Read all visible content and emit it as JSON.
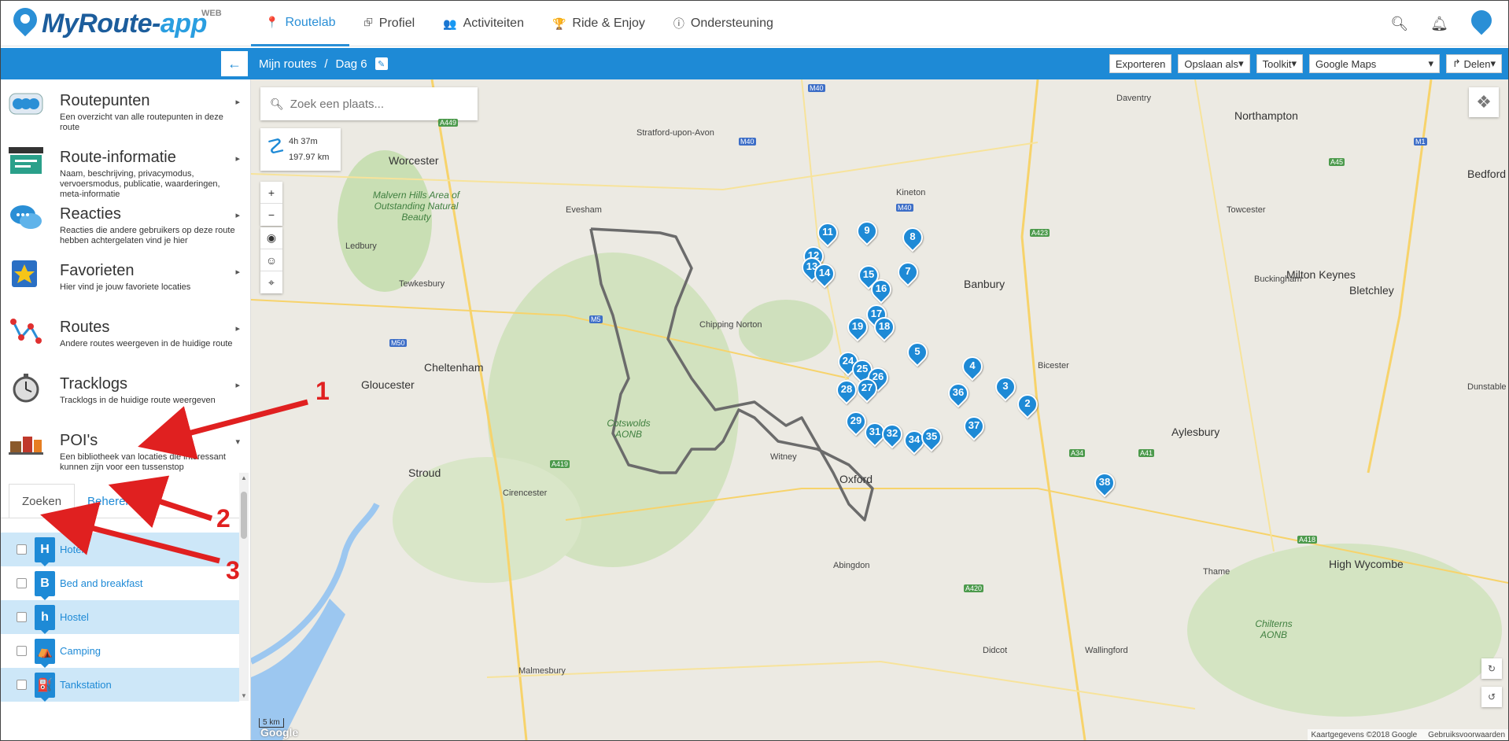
{
  "app": {
    "logo_main": "MyRoute-",
    "logo_accent": "app",
    "logo_badge": "WEB"
  },
  "nav": {
    "items": [
      {
        "label": "Routelab",
        "icon": "map-marker-icon"
      },
      {
        "label": "Profiel",
        "icon": "share-icon"
      },
      {
        "label": "Activiteiten",
        "icon": "users-icon"
      },
      {
        "label": "Ride & Enjoy",
        "icon": "trophy-icon"
      },
      {
        "label": "Ondersteuning",
        "icon": "info-icon"
      }
    ]
  },
  "breadcrumb": {
    "root": "Mijn routes",
    "separator": "/",
    "current": "Dag 6"
  },
  "toolbar": {
    "export": "Exporteren",
    "save_as": "Opslaan als",
    "toolkit": "Toolkit",
    "map_type": "Google Maps",
    "share": "Delen"
  },
  "sidebar": {
    "items": [
      {
        "title": "Routepunten",
        "desc": "Een overzicht van alle routepunten in deze route"
      },
      {
        "title": "Route-informatie",
        "desc": "Naam, beschrijving, privacymodus, vervoersmodus, publicatie, waarderingen, meta-informatie"
      },
      {
        "title": "Reacties",
        "desc": "Reacties die andere gebruikers op deze route hebben achtergelaten vind je hier"
      },
      {
        "title": "Favorieten",
        "desc": "Hier vind je jouw favoriete locaties"
      },
      {
        "title": "Routes",
        "desc": "Andere routes weergeven in de huidige route"
      },
      {
        "title": "Tracklogs",
        "desc": "Tracklogs in de huidige route weergeven"
      },
      {
        "title": "POI's",
        "desc": "Een bibliotheek van locaties die interessant kunnen zijn voor een tussenstop"
      }
    ],
    "tabs": [
      "Zoeken",
      "Beheren"
    ],
    "poi_categories": [
      {
        "label": "Hotel",
        "glyph": "H"
      },
      {
        "label": "Bed and breakfast",
        "glyph": "B"
      },
      {
        "label": "Hostel",
        "glyph": "h"
      },
      {
        "label": "Camping",
        "glyph": "⛺"
      },
      {
        "label": "Tankstation",
        "glyph": "⛽"
      }
    ]
  },
  "map": {
    "search_placeholder": "Zoek een plaats...",
    "duration": "4h 37m",
    "distance": "197.97 km",
    "scale": "5 km",
    "google": "Google",
    "attribution": "Kaartgegevens ©2018 Google",
    "terms": "Gebruiksvoorwaarden",
    "places": [
      {
        "name": "Northampton",
        "big": true
      },
      {
        "name": "Worcester",
        "big": true
      },
      {
        "name": "Banbury",
        "big": true
      },
      {
        "name": "Milton Keynes",
        "big": true
      },
      {
        "name": "Bletchley",
        "big": false
      },
      {
        "name": "Cheltenham",
        "big": true
      },
      {
        "name": "Gloucester",
        "big": true
      },
      {
        "name": "Oxford",
        "big": true
      },
      {
        "name": "Aylesbury",
        "big": true
      },
      {
        "name": "Stroud",
        "big": true
      },
      {
        "name": "Bicester",
        "big": false
      },
      {
        "name": "High Wycombe",
        "big": true
      },
      {
        "name": "Stratford-upon-Avon",
        "big": false
      },
      {
        "name": "Evesham",
        "big": false
      },
      {
        "name": "Tewkesbury",
        "big": false
      },
      {
        "name": "Cirencester",
        "big": false
      },
      {
        "name": "Abingdon",
        "big": false
      },
      {
        "name": "Witney",
        "big": false
      },
      {
        "name": "Bedford",
        "big": true
      },
      {
        "name": "Dunstable",
        "big": false
      },
      {
        "name": "Ledbury",
        "big": false
      },
      {
        "name": "Daventry",
        "big": false
      },
      {
        "name": "Towcester",
        "big": false
      },
      {
        "name": "Buckingham",
        "big": false
      },
      {
        "name": "Chipping Norton",
        "big": false
      },
      {
        "name": "Wallingford",
        "big": false
      },
      {
        "name": "Didcot",
        "big": false
      },
      {
        "name": "Thame",
        "big": false
      },
      {
        "name": "Kineton",
        "big": false
      },
      {
        "name": "Malmesbury",
        "big": false
      }
    ],
    "areas": [
      {
        "name": "Malvern Hills Area of Outstanding Natural Beauty"
      },
      {
        "name": "Cotswolds AONB"
      },
      {
        "name": "Chilterns AONB"
      }
    ],
    "markers": [
      "2",
      "3",
      "4",
      "5",
      "7",
      "8",
      "9",
      "11",
      "12",
      "13",
      "14",
      "15",
      "16",
      "17",
      "18",
      "19",
      "24",
      "25",
      "26",
      "27",
      "28",
      "29",
      "31",
      "32",
      "34",
      "35",
      "36",
      "37",
      "38"
    ]
  },
  "annotations": [
    "1",
    "2",
    "3"
  ],
  "colors": {
    "brand_blue": "#1e8ad6",
    "annotation_red": "#e02020",
    "route_gray": "#6b6b6b"
  }
}
